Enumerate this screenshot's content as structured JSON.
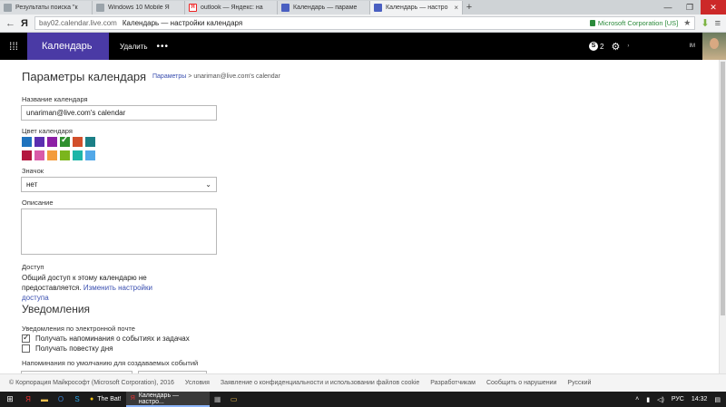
{
  "browser": {
    "tabs": [
      {
        "label": "Результаты поиска \"к",
        "icon": "page-icon"
      },
      {
        "label": "Windows 10 Mobile Я",
        "icon": "page-icon"
      },
      {
        "label": "outlook — Яндекс: на",
        "icon": "yandex-icon"
      },
      {
        "label": "Календарь — парамe",
        "icon": "calendar-icon"
      },
      {
        "label": "Календарь — настро",
        "icon": "calendar-icon",
        "active": true
      }
    ],
    "new_tab": "+",
    "address_host": "bay02.calendar.live.com",
    "address_title": "Календарь — настройки календаря",
    "cert": "Microsoft Corporation [US]"
  },
  "header": {
    "app_name": "Календарь",
    "delete_label": "Удалить",
    "more_label": "•••",
    "skype_count": "2",
    "user_initials": "IM"
  },
  "page": {
    "title": "Параметры календаря",
    "breadcrumb_link": "Параметры",
    "breadcrumb_sep": " > ",
    "breadcrumb_current": "unariman@live.com's calendar",
    "name_label": "Название календаря",
    "name_value": "unariman@live.com's calendar",
    "color_label": "Цвет календаря",
    "colors": [
      "#1e73be",
      "#5b2fb0",
      "#8c1fa5",
      "#2f8f2f",
      "#d24f2b",
      "#1b7f86",
      "#b3173f",
      "#d95aa8",
      "#f39c3c",
      "#7bb51d",
      "#1eb5a8",
      "#52a8e8"
    ],
    "selected_color_index": 3,
    "icon_label": "Значок",
    "icon_value": "нет",
    "description_label": "Описание",
    "access_label": "Доступ",
    "access_text": "Общий доступ к этому календарю не предоставляется.",
    "access_link": "Изменить настройки доступа",
    "notifications_heading": "Уведомления",
    "email_notifications_label": "Уведомления по электронной почте",
    "check_reminders": "Получать напоминания о событиях и задачах",
    "check_agenda": "Получать повестку дня",
    "default_reminders_label": "Напоминания по умолчанию для создаваемых событий"
  },
  "footer": {
    "copyright": "© Корпорация Майкрософт (Microsoft Corporation), 2016",
    "terms": "Условия",
    "privacy": "Заявление о конфиденциальности и использовании файлов cookie",
    "developers": "Разработчикам",
    "report": "Сообщить о нарушении",
    "language": "Русский"
  },
  "taskbar": {
    "bat_label": "The Bat!",
    "browser_label": "Календарь — настро...",
    "lang": "РУС",
    "time": "14:32"
  }
}
